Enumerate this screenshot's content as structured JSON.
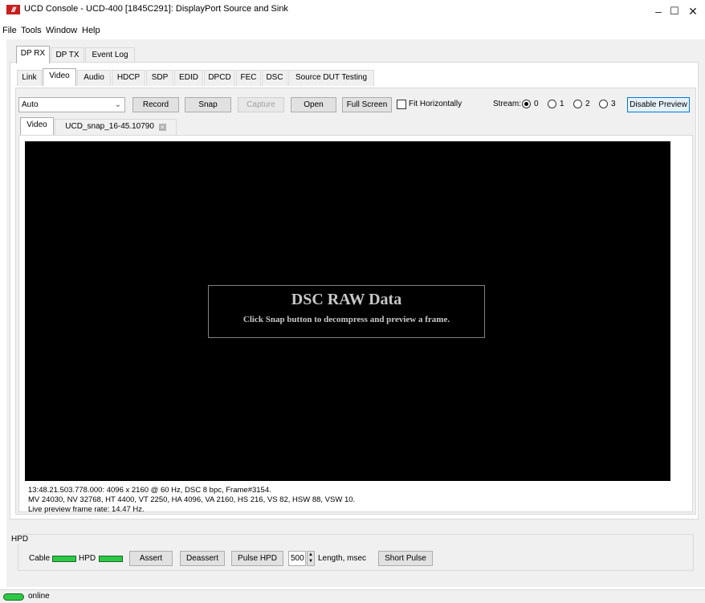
{
  "window": {
    "logo_text": "///",
    "title": "UCD Console - UCD-400 [1845C291]: DisplayPort Source and Sink",
    "minimize": "–",
    "maximize": "☐",
    "close": "✕"
  },
  "menu": [
    "File",
    "Tools",
    "Window",
    "Help"
  ],
  "top_tabs": [
    "DP RX",
    "DP TX",
    "Event Log"
  ],
  "sub_tabs": [
    "Link",
    "Video",
    "Audio",
    "HDCP",
    "SDP",
    "EDID",
    "DPCD",
    "FEC",
    "DSC",
    "Source DUT Testing"
  ],
  "toolbar": {
    "mode_value": "Auto",
    "record": "Record",
    "snap": "Snap",
    "capture": "Capture",
    "open": "Open",
    "full_screen": "Full Screen",
    "fit_horizontally": "Fit Horizontally",
    "stream_label": "Stream:",
    "streams": [
      "0",
      "1",
      "2",
      "3"
    ],
    "selected_stream": "0",
    "disable_preview": "Disable Preview"
  },
  "video_tabs": [
    "Video",
    "UCD_snap_16-45.10790"
  ],
  "preview": {
    "title": "DSC RAW Data",
    "subtitle": "Click Snap button to decompress and preview a frame."
  },
  "status_lines": [
    "13:48.21.503.778.000: 4096 x 2160 @ 60 Hz, DSC 8 bpc, Frame#3154.",
    "MV 24030, NV 32768, HT 4400, VT 2250, HA 4096, VA 2160, HS 216, VS 82, HSW 88, VSW 10.",
    "Live preview frame rate: 14.47 Hz."
  ],
  "hpd": {
    "group_label": "HPD",
    "cable_label": "Cable",
    "hpd_label": "HPD",
    "assert": "Assert",
    "deassert": "Deassert",
    "pulse_hpd": "Pulse HPD",
    "length_value": "500",
    "length_label": "Length, msec",
    "short_pulse": "Short Pulse"
  },
  "status_bar": {
    "state": "online"
  },
  "colors": {
    "brand": "#c81e1e",
    "indicator_green": "#2dc846",
    "focus_blue": "#0078d7"
  }
}
